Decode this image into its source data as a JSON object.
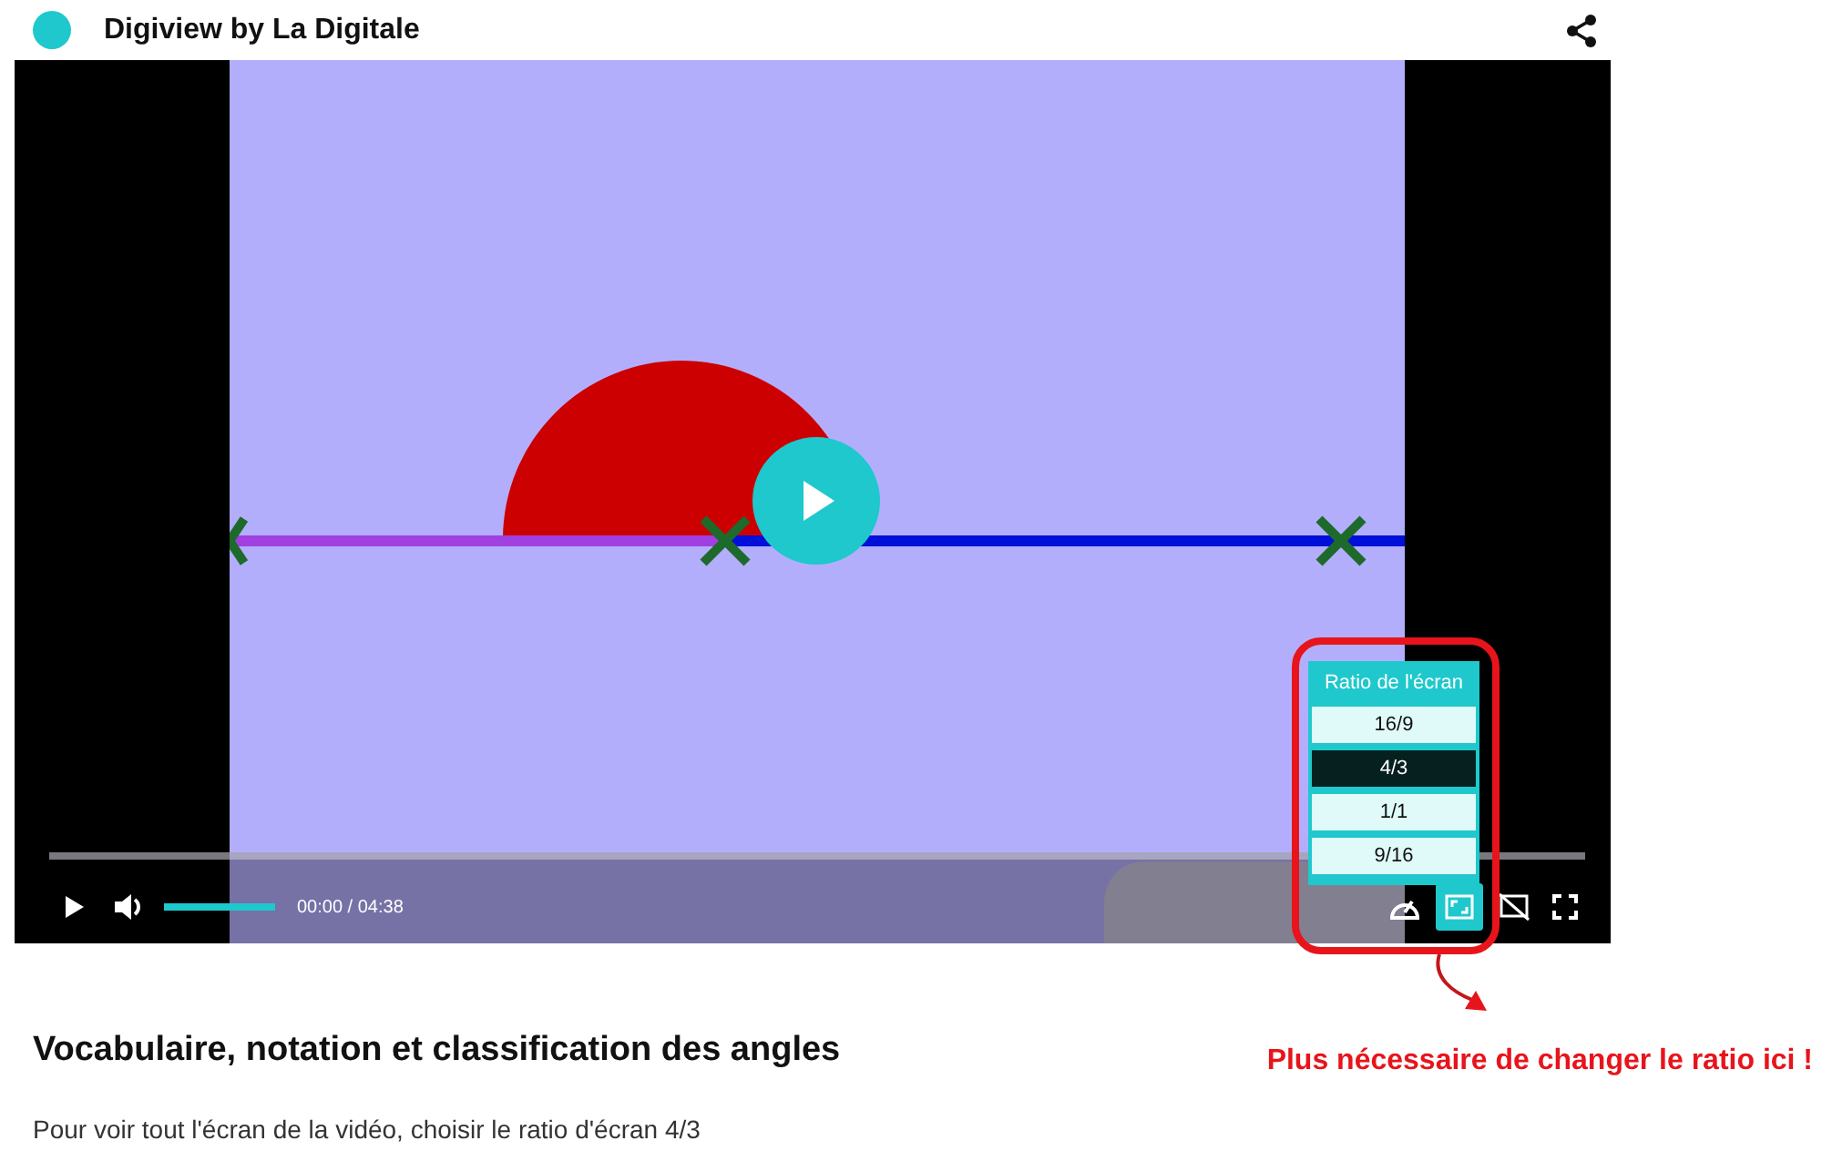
{
  "header": {
    "title": "Digiview by La Digitale"
  },
  "player": {
    "progress": {
      "level": 0
    },
    "volume": {
      "level": 1
    },
    "time": "00:00 / 04:38",
    "ratio_menu": {
      "title": "Ratio de l'écran",
      "options": [
        {
          "label": "16/9",
          "selected": false
        },
        {
          "label": "4/3",
          "selected": true
        },
        {
          "label": "1/1",
          "selected": false
        },
        {
          "label": "9/16",
          "selected": false
        }
      ]
    },
    "ratio_button": {
      "active": true
    }
  },
  "video_info": {
    "title": "Vocabulaire, notation et classification des angles",
    "description": "Pour voir tout l'écran de la vidéo, choisir le ratio d'écran 4/3"
  },
  "annotation": {
    "text": "Plus nécessaire de changer le ratio ici !"
  }
}
